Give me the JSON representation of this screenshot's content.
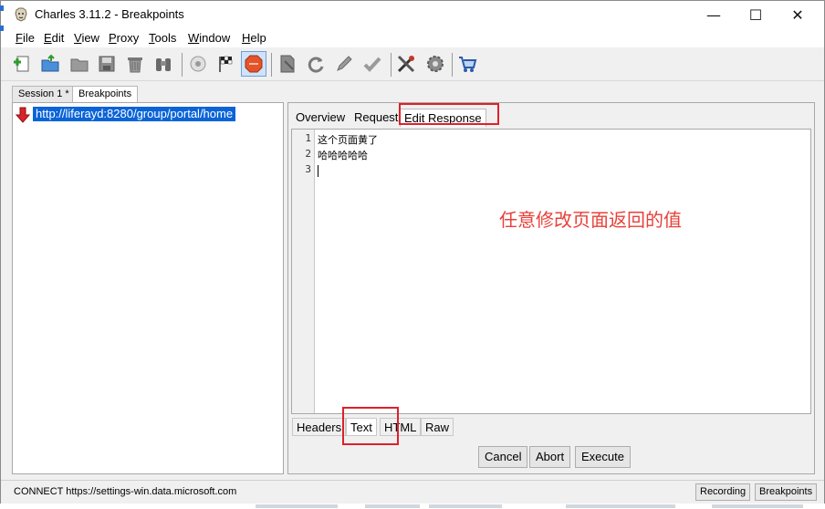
{
  "window": {
    "title": "Charles 3.11.2 - Breakpoints",
    "controls": {
      "minimize": "—",
      "maximize": "☐",
      "close": "✕"
    }
  },
  "menubar": [
    {
      "label": "File",
      "accel": "F",
      "rest": "ile"
    },
    {
      "label": "Edit",
      "accel": "E",
      "rest": "dit"
    },
    {
      "label": "View",
      "accel": "V",
      "rest": "iew"
    },
    {
      "label": "Proxy",
      "accel": "P",
      "rest": "roxy"
    },
    {
      "label": "Tools",
      "accel": "T",
      "rest": "ools"
    },
    {
      "label": "Window",
      "accel": "W",
      "rest": "indow"
    },
    {
      "label": "Help",
      "accel": "H",
      "rest": "elp"
    }
  ],
  "toolbar": {
    "icons": [
      "new-session-icon",
      "open-folder-icon",
      "close-session-icon",
      "save-icon",
      "trash-icon",
      "binoculars-icon",
      "record-icon",
      "throttle-flag-icon",
      "breakpoints-stop-icon",
      "compose-icon",
      "repeat-icon",
      "edit-pencil-icon",
      "validate-check-icon",
      "tools-icon",
      "settings-gear-icon",
      "shopping-cart-icon"
    ],
    "active": "breakpoints-stop-icon"
  },
  "session_tabs": [
    {
      "label": "Session 1 *",
      "selected": false
    },
    {
      "label": "Breakpoints",
      "selected": true
    }
  ],
  "tree": {
    "items": [
      {
        "url": "http://liferayd:8280/group/portal/home",
        "selected": true
      }
    ]
  },
  "detail": {
    "tabs": [
      {
        "label": "Overview",
        "selected": false
      },
      {
        "label": "Request",
        "selected": false
      },
      {
        "label": "Edit Response",
        "selected": true
      }
    ],
    "editor": {
      "lines": [
        {
          "num": "1",
          "text": "这个页面黄了"
        },
        {
          "num": "2",
          "text": "哈哈哈哈哈"
        },
        {
          "num": "3",
          "text": ""
        }
      ]
    },
    "annotation": "任意修改页面返回的值",
    "bottom_tabs": [
      {
        "label": "Headers",
        "selected": false
      },
      {
        "label": "Text",
        "selected": true
      },
      {
        "label": "HTML",
        "selected": false
      },
      {
        "label": "Raw",
        "selected": false
      }
    ],
    "actions": {
      "cancel": "Cancel",
      "abort": "Abort",
      "execute": "Execute"
    }
  },
  "status": {
    "message": "CONNECT https://settings-win.data.microsoft.com",
    "recording": "Recording",
    "breakpoints": "Breakpoints"
  },
  "colors": {
    "selection": "#0a64d8",
    "highlight_box": "#e0202a",
    "annotation": "#e8413a",
    "stop_icon": "#e4532a"
  }
}
